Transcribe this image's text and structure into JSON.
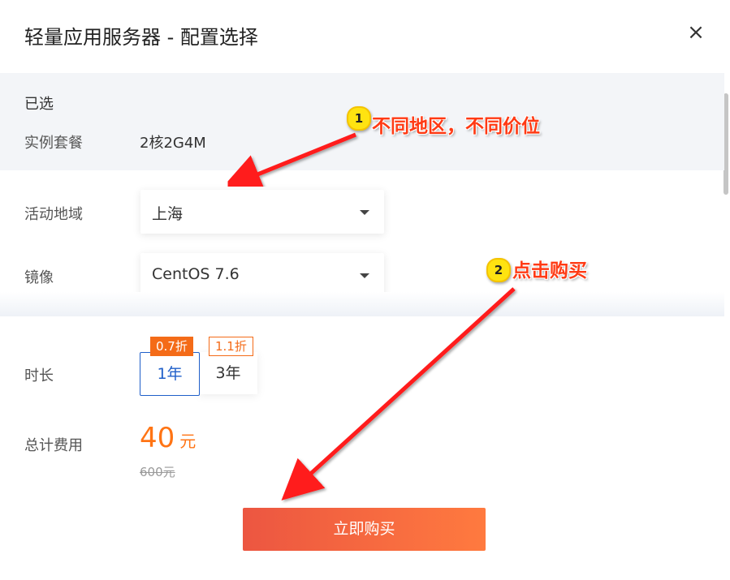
{
  "dialog": {
    "title": "轻量应用服务器 - 配置选择",
    "close_icon": "×"
  },
  "selected": {
    "heading": "已选",
    "plan_label": "实例套餐",
    "plan_value": "2核2G4M"
  },
  "region": {
    "label": "活动地域",
    "value": "上海"
  },
  "image": {
    "label": "镜像",
    "value": "CentOS 7.6"
  },
  "duration": {
    "label": "时长",
    "options": [
      {
        "label": "1年",
        "tag": "0.7折",
        "selected": true
      },
      {
        "label": "3年",
        "tag": "1.1折",
        "selected": false
      }
    ]
  },
  "total": {
    "label": "总计费用",
    "price": "40",
    "unit": "元",
    "original": "600元"
  },
  "buy_button": "立即购买",
  "annotations": [
    {
      "number": "1",
      "text": "不同地区，不同价位"
    },
    {
      "number": "2",
      "text": "点击购买"
    }
  ],
  "colors": {
    "accent_orange": "#ff7414",
    "selected_blue": "#1f5fc9",
    "arrow_red": "#ff1a1a"
  }
}
